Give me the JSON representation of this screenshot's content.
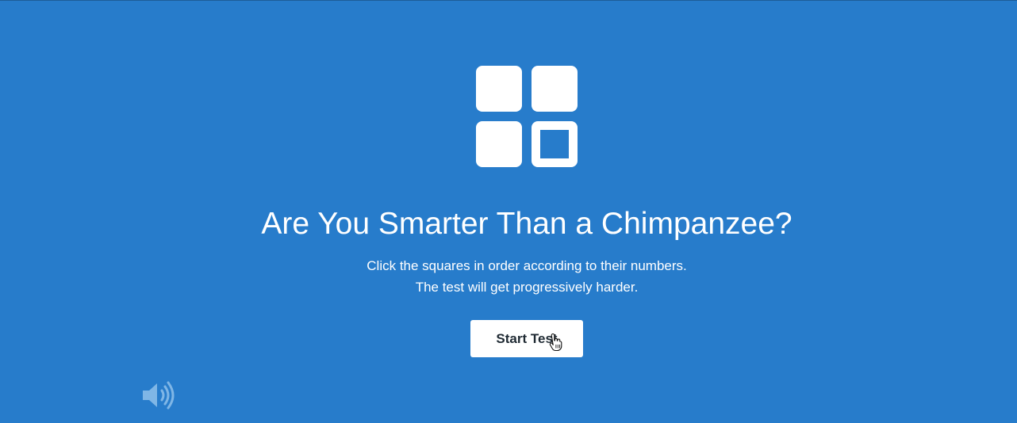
{
  "colors": {
    "background": "#277ccb",
    "foreground": "#ffffff",
    "button_text": "#1f2a33",
    "sound_icon": "#7fb6e6"
  },
  "logo": {
    "icon": "chimp-test-squares-icon"
  },
  "heading": "Are You Smarter Than a Chimpanzee?",
  "description": {
    "line1": "Click the squares in order according to their numbers.",
    "line2": "The test will get progressively harder."
  },
  "start_button": {
    "label": "Start Test"
  },
  "sound_toggle": {
    "icon": "speaker-volume-icon"
  }
}
